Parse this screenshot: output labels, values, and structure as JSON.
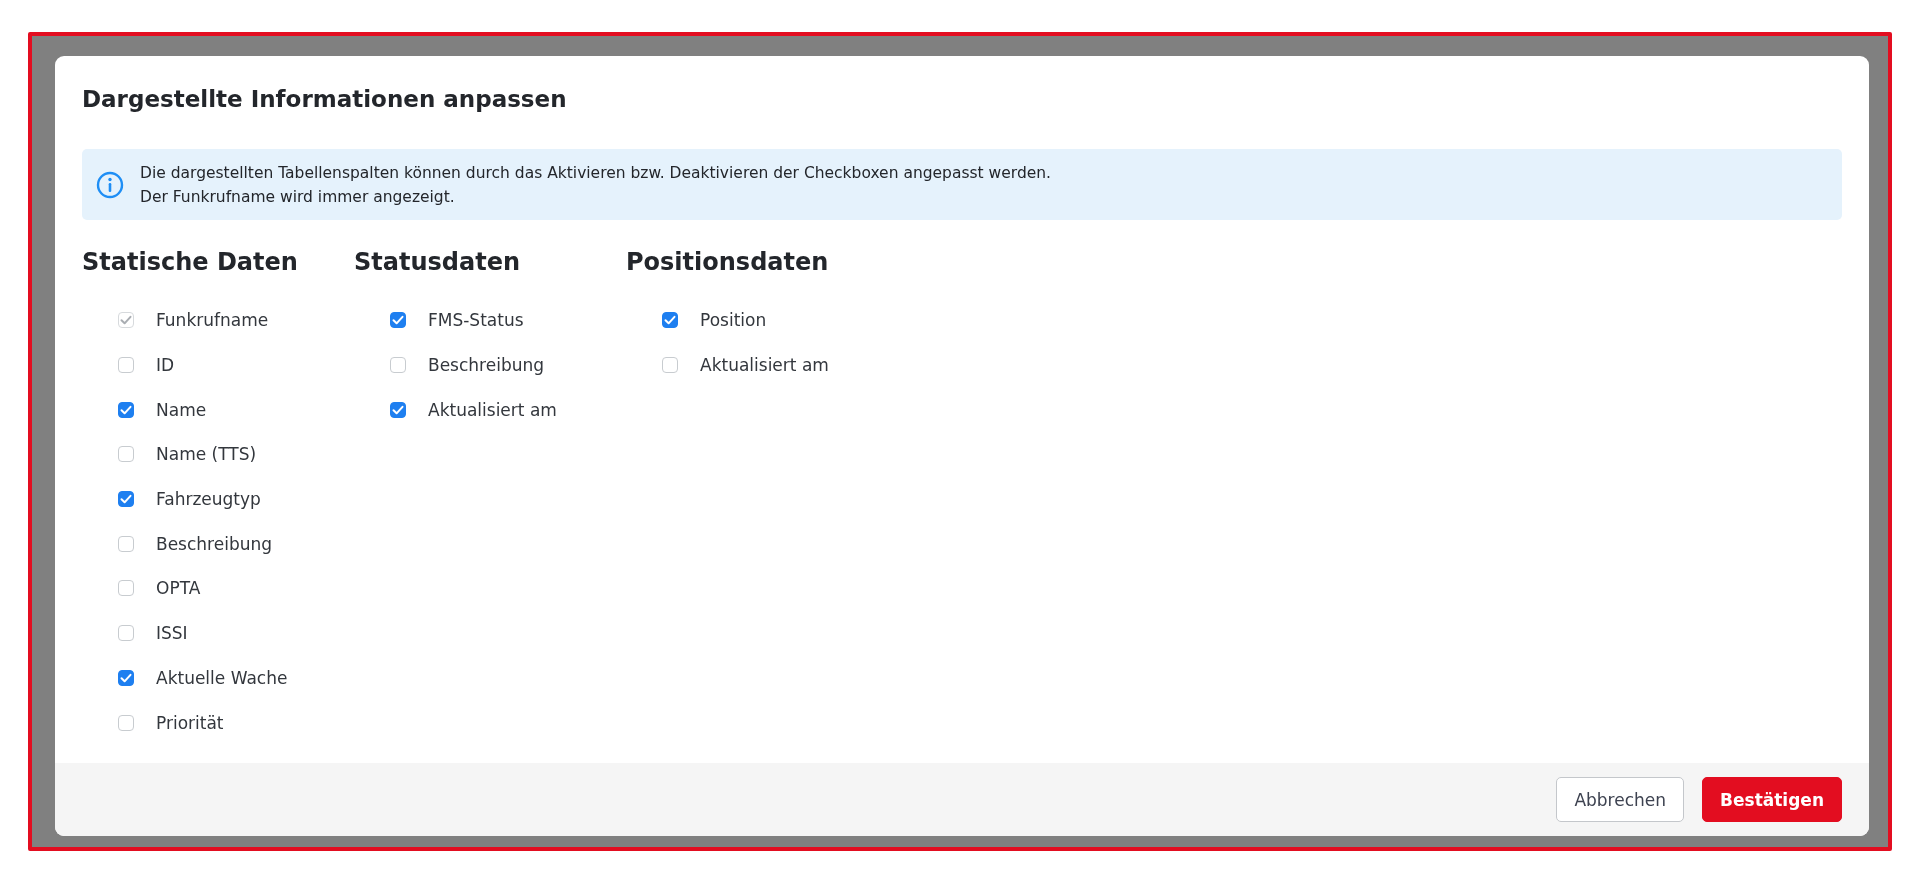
{
  "dialog": {
    "title": "Dargestellte Informationen anpassen",
    "info": [
      "Die dargestellten Tabellenspalten können durch das Aktivieren bzw. Deaktivieren der Checkboxen angepasst werden.",
      "Der Funkrufname wird immer angezeigt."
    ],
    "groups": [
      {
        "title": "Statische Daten",
        "items": [
          {
            "label": "Funkrufname",
            "checked": true,
            "disabled": true
          },
          {
            "label": "ID",
            "checked": false,
            "disabled": false
          },
          {
            "label": "Name",
            "checked": true,
            "disabled": false
          },
          {
            "label": "Name (TTS)",
            "checked": false,
            "disabled": false
          },
          {
            "label": "Fahrzeugtyp",
            "checked": true,
            "disabled": false
          },
          {
            "label": "Beschreibung",
            "checked": false,
            "disabled": false
          },
          {
            "label": "OPTA",
            "checked": false,
            "disabled": false
          },
          {
            "label": "ISSI",
            "checked": false,
            "disabled": false
          },
          {
            "label": "Aktuelle Wache",
            "checked": true,
            "disabled": false
          },
          {
            "label": "Priorität",
            "checked": false,
            "disabled": false
          }
        ]
      },
      {
        "title": "Statusdaten",
        "items": [
          {
            "label": "FMS-Status",
            "checked": true,
            "disabled": false
          },
          {
            "label": "Beschreibung",
            "checked": false,
            "disabled": false
          },
          {
            "label": "Aktualisiert am",
            "checked": true,
            "disabled": false
          }
        ]
      },
      {
        "title": "Positionsdaten",
        "items": [
          {
            "label": "Position",
            "checked": true,
            "disabled": false
          },
          {
            "label": "Aktualisiert am",
            "checked": false,
            "disabled": false
          }
        ]
      }
    ],
    "buttons": [
      {
        "label": "Abbrechen",
        "kind": "secondary"
      },
      {
        "label": "Bestätigen",
        "kind": "primary"
      }
    ]
  }
}
